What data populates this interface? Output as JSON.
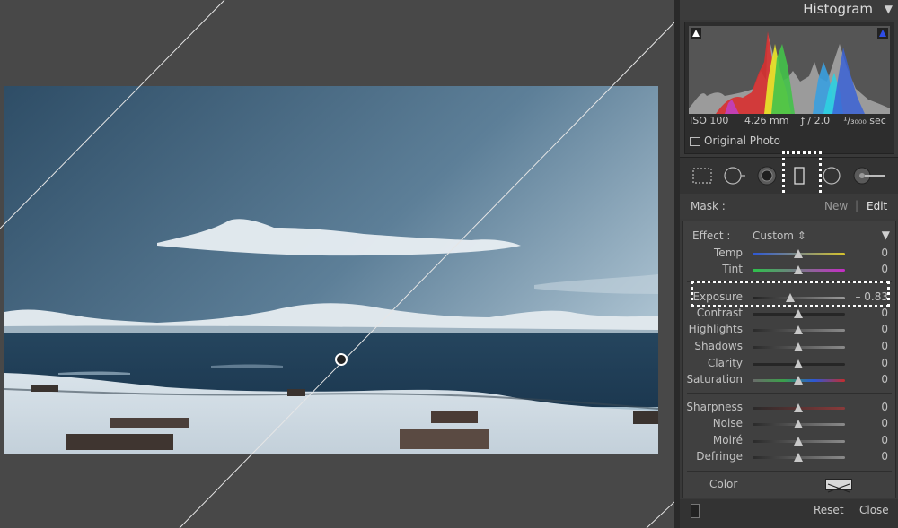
{
  "histogram": {
    "title": "Histogram",
    "iso": "ISO 100",
    "focal": "4.26 mm",
    "aperture": "ƒ / 2.0",
    "shutter": "¹/₃₀₀₀ sec",
    "original_photo": "Original Photo"
  },
  "tools": [
    "crop-overlay-icon",
    "spot-removal-icon",
    "red-eye-icon",
    "graduated-filter-icon",
    "radial-filter-icon",
    "adjustment-brush-icon"
  ],
  "mask": {
    "label": "Mask :",
    "new": "New",
    "edit": "Edit"
  },
  "effect": {
    "label": "Effect :",
    "value": "Custom ⇕"
  },
  "sliders": [
    {
      "label": "Temp",
      "value": "0"
    },
    {
      "label": "Tint",
      "value": "0"
    },
    {
      "label": "Exposure",
      "value": "– 0.83"
    },
    {
      "label": "Contrast",
      "value": "0"
    },
    {
      "label": "Highlights",
      "value": "0"
    },
    {
      "label": "Shadows",
      "value": "0"
    },
    {
      "label": "Clarity",
      "value": "0"
    },
    {
      "label": "Saturation",
      "value": "0"
    },
    {
      "label": "Sharpness",
      "value": "0"
    },
    {
      "label": "Noise",
      "value": "0"
    },
    {
      "label": "Moiré",
      "value": "0"
    },
    {
      "label": "Defringe",
      "value": "0"
    }
  ],
  "color": {
    "label": "Color"
  },
  "footer": {
    "reset": "Reset",
    "close": "Close"
  },
  "colors": {
    "panel_bg": "#393939",
    "canvas_bg": "#484848",
    "highlight_dots": "#ffffff"
  }
}
